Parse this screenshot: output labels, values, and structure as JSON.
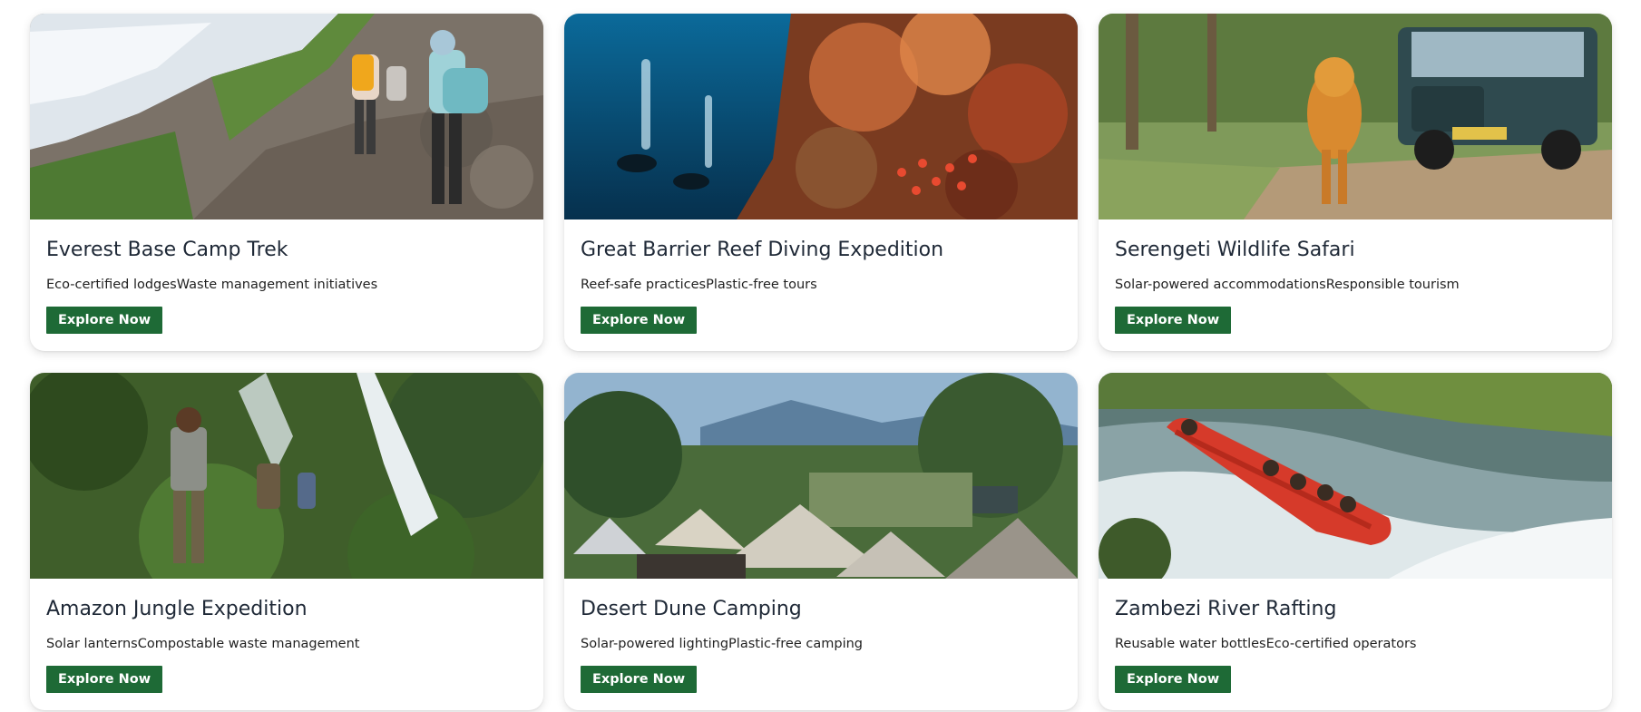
{
  "cards": [
    {
      "title": "Everest Base Camp Trek",
      "features": "Eco-certified lodgesWaste management initiatives",
      "button_label": "Explore Now",
      "image_alt": "Hikers trekking up a rocky mountain trail"
    },
    {
      "title": "Great Barrier Reef Diving Expedition",
      "features": "Reef-safe practicesPlastic-free tours",
      "button_label": "Explore Now",
      "image_alt": "Scuba divers beside a coral reef"
    },
    {
      "title": "Serengeti Wildlife Safari",
      "features": "Solar-powered accommodationsResponsible tourism",
      "button_label": "Explore Now",
      "image_alt": "Tiger walking near a safari jeep"
    },
    {
      "title": "Amazon Jungle Expedition",
      "features": "Solar lanternsCompostable waste management",
      "button_label": "Explore Now",
      "image_alt": "Trekkers walking through jungle near a waterfall"
    },
    {
      "title": "Desert Dune Camping",
      "features": "Solar-powered lightingPlastic-free camping",
      "button_label": "Explore Now",
      "image_alt": "Tent camp among trees with mountains behind"
    },
    {
      "title": "Zambezi River Rafting",
      "features": "Reusable water bottlesEco-certified operators",
      "button_label": "Explore Now",
      "image_alt": "Red raft running river rapids"
    }
  ],
  "colors": {
    "button_bg": "#1e6a36",
    "title_text": "#1f2937"
  }
}
